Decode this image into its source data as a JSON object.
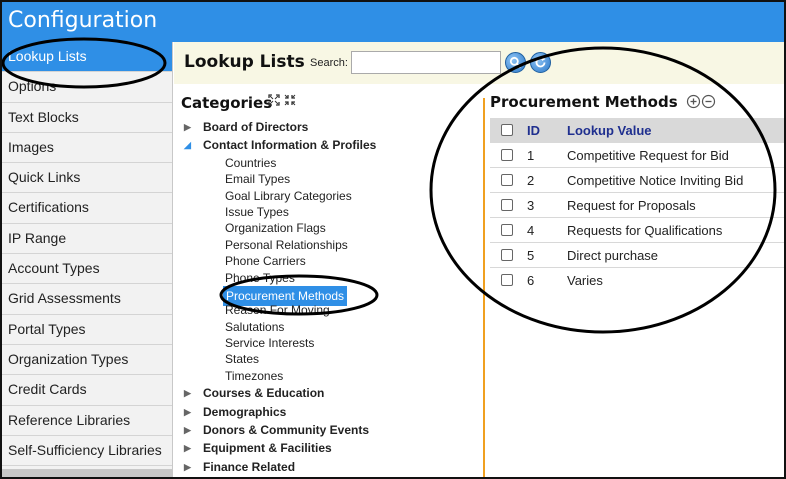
{
  "app": {
    "title": "Configuration"
  },
  "sidebar": {
    "items": [
      {
        "label": "Lookup Lists",
        "active": true
      },
      {
        "label": "Options"
      },
      {
        "label": "Text Blocks"
      },
      {
        "label": "Images"
      },
      {
        "label": "Quick Links"
      },
      {
        "label": "Certifications"
      },
      {
        "label": "IP Range"
      },
      {
        "label": "Account Types"
      },
      {
        "label": "Grid Assessments"
      },
      {
        "label": "Portal Types"
      },
      {
        "label": "Organization Types"
      },
      {
        "label": "Credit Cards"
      },
      {
        "label": "Reference Libraries"
      },
      {
        "label": "Self-Sufficiency Libraries"
      }
    ]
  },
  "toolbar": {
    "title": "Lookup Lists",
    "search_label": "Search:",
    "search_value": "",
    "search_icon": "search-icon",
    "refresh_icon": "refresh-icon"
  },
  "categories": {
    "title": "Categories",
    "expand_icon": "expand-icon",
    "collapse_icon": "collapse-icon",
    "items": [
      {
        "label": "Board of Directors",
        "expanded": false
      },
      {
        "label": "Contact Information & Profiles",
        "expanded": true,
        "children": [
          "Countries",
          "Email Types",
          "Goal Library Categories",
          "Issue Types",
          "Organization Flags",
          "Personal Relationships",
          "Phone Carriers",
          "Phone Types",
          "Procurement Methods",
          "Reason For Moving",
          "Salutations",
          "Service Interests",
          "States",
          "Timezones"
        ],
        "selected_child": "Procurement Methods"
      },
      {
        "label": "Courses & Education",
        "expanded": false
      },
      {
        "label": "Demographics",
        "expanded": false
      },
      {
        "label": "Donors & Community Events",
        "expanded": false
      },
      {
        "label": "Equipment & Facilities",
        "expanded": false
      },
      {
        "label": "Finance Related",
        "expanded": false
      }
    ]
  },
  "procurement": {
    "title": "Procurement Methods",
    "add_icon": "plus-circle-icon",
    "remove_icon": "minus-circle-icon",
    "columns": {
      "id": "ID",
      "value": "Lookup Value"
    },
    "rows": [
      {
        "id": "1",
        "value": "Competitive Request for Bid"
      },
      {
        "id": "2",
        "value": "Competitive Notice Inviting Bid"
      },
      {
        "id": "3",
        "value": "Request for Proposals"
      },
      {
        "id": "4",
        "value": "Requests for Qualifications"
      },
      {
        "id": "5",
        "value": "Direct purchase"
      },
      {
        "id": "6",
        "value": "Varies"
      }
    ]
  },
  "annotations": {
    "color": "#000000"
  }
}
